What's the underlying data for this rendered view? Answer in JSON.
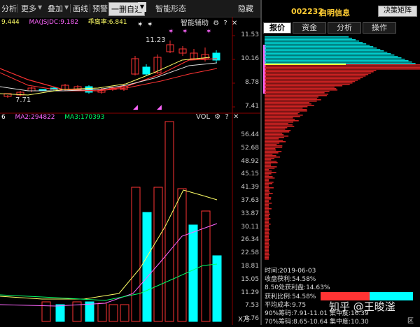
{
  "toolbar": {
    "items": [
      "分析",
      "更多",
      "叠加",
      "画线",
      "预警"
    ],
    "selfselect": "一删自选",
    "smart": "智能形态",
    "hide": "隐藏"
  },
  "upper": {
    "ma_labels": [
      {
        "text": "9.444",
        "color": "#ffff66"
      },
      {
        "text": "MA(JSJDC:9.182",
        "color": "#ff66ff"
      },
      {
        "text": "乖离率:6.841",
        "color": "#ffff66"
      }
    ],
    "assist": "智能辅助",
    "high_label": "11.23",
    "low_label": "7.71",
    "price_ticks": [
      "11.53",
      "10.16",
      "8.78",
      "7.41"
    ]
  },
  "lower": {
    "ma_labels": [
      {
        "text": "6",
        "color": "#ffffff"
      },
      {
        "text": "MA2:294822",
        "color": "#ff66ff"
      },
      {
        "text": "MA3:170393",
        "color": "#00ff66"
      }
    ],
    "title": "VOL",
    "unit": "X万",
    "vol_ticks": [
      "56.44",
      "52.68",
      "48.92",
      "45.15",
      "41.39",
      "37.63",
      "33.87",
      "30.11",
      "26.34",
      "22.58",
      "18.81",
      "15.05",
      "11.29",
      "7.53",
      "3.76"
    ]
  },
  "right": {
    "code": "002232",
    "name": "启明信息",
    "button": "决策矩阵",
    "tabs": [
      "报价",
      "资金",
      "分析",
      "操作"
    ],
    "stats": [
      {
        "label": "时",
        "value": "间:2019-06-03"
      },
      {
        "label": "收盘获利:",
        "value": "54.58%"
      },
      {
        "label": "8.50处获利盘:",
        "value": "14.63%"
      },
      {
        "label": "获利比例:",
        "value": "54.58%"
      },
      {
        "label": "平均成本:",
        "value": "9.75"
      },
      {
        "label": "90%筹码:",
        "value": "7.91-11.01  集中度:16.39"
      },
      {
        "label": "70%筹码:",
        "value": "8.65-10.64  集中度:10.30"
      }
    ],
    "watermark": "知乎 @王晙滏",
    "bottom_label": "区"
  },
  "colors": {
    "up": "#ff3333",
    "down": "#00ffff",
    "ma5": "#ffff66",
    "ma10": "#ff66ff",
    "ma20": "#00ff66",
    "ma30": "#ff3333"
  }
}
